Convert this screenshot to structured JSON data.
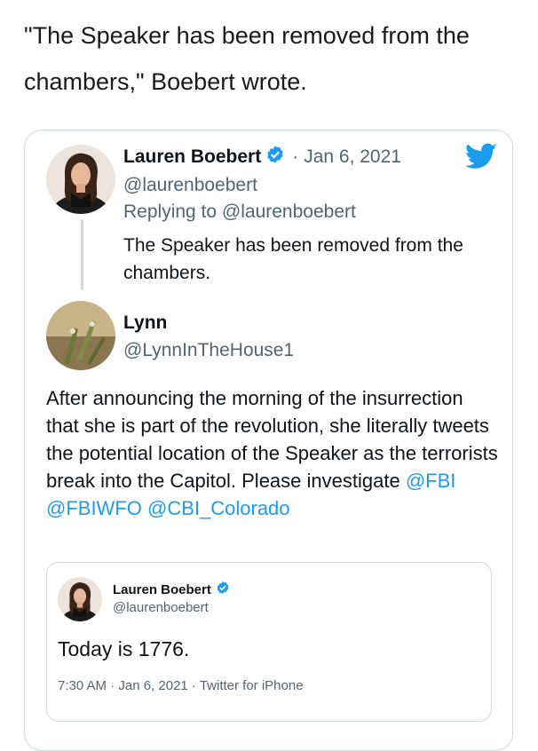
{
  "caption": "\"The Speaker has been removed from the chambers,\" Boebert wrote.",
  "colors": {
    "twitter_blue": "#1d9bf0",
    "muted_text": "#536471",
    "border": "#cfd9de"
  },
  "reply_tweet": {
    "author_name": "Lauren Boebert",
    "verified_icon": "verified-badge-icon",
    "date_separator": "·",
    "date": "Jan 6, 2021",
    "handle": "@laurenboebert",
    "replying_prefix": "Replying to ",
    "replying_to": "@laurenboebert",
    "text": "The Speaker has been removed from the chambers."
  },
  "main_tweet": {
    "author_name": "Lynn",
    "handle": "@LynnInTheHouse1",
    "text": "After announcing the morning of the insurrection that she is part of the revolution, she literally tweets the potential location of the Speaker as the terrorists break into the Capitol. Please investigate ",
    "mentions": [
      "@FBI",
      "@FBIWFO",
      "@CBI_Colorado"
    ]
  },
  "quoted_tweet": {
    "author_name": "Lauren Boebert",
    "handle": "@laurenboebert",
    "text": "Today is 1776.",
    "meta": "7:30 AM · Jan 6, 2021 · Twitter for iPhone"
  }
}
